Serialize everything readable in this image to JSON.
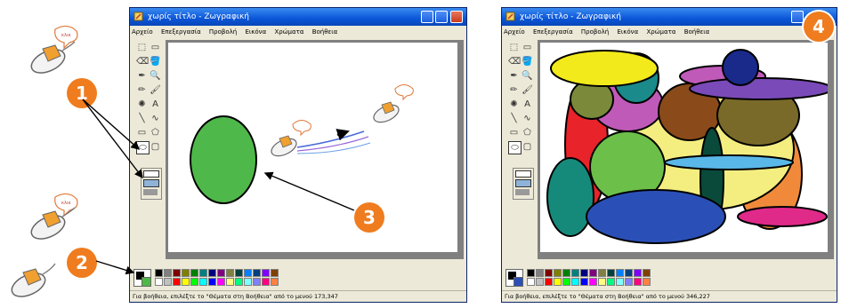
{
  "window1": {
    "title": "χωρίς τίτλο - Ζωγραφική",
    "menus": [
      "Αρχείο",
      "Επεξεργασία",
      "Προβολή",
      "Εικόνα",
      "Χρώματα",
      "Βοήθεια"
    ],
    "status": "Για βοήθεια, επιλέξτε το \"Θέματα στη Βοήθεια\" από το μενού  173,347"
  },
  "window2": {
    "title": "χωρίς τίτλο - Ζωγραφική",
    "menus": [
      "Αρχείο",
      "Επεξεργασία",
      "Προβολή",
      "Εικόνα",
      "Χρώματα",
      "Βοήθεια"
    ],
    "status": "Για βοήθεια, επιλέξτε το \"Θέματα στη Βοήθεια\" από το μενού  346,227"
  },
  "badges": [
    "1",
    "2",
    "3",
    "4"
  ],
  "mouse_label": "κλικ",
  "tools": [
    "free-select-icon",
    "select-icon",
    "eraser-icon",
    "fill-icon",
    "picker-icon",
    "magnifier-icon",
    "pencil-icon",
    "brush-icon",
    "airbrush-icon",
    "text-icon",
    "line-icon",
    "curve-icon",
    "rectangle-icon",
    "polygon-icon",
    "ellipse-icon",
    "rounded-rect-icon"
  ],
  "tool_glyphs": [
    "⬚",
    "▭",
    "⌫",
    "🪣",
    "✒",
    "🔍",
    "✏",
    "🖌",
    "✺",
    "A",
    "╲",
    "∿",
    "▭",
    "⬠",
    "⬭",
    "▢"
  ],
  "palette_colors": [
    "#000000",
    "#808080",
    "#800000",
    "#808000",
    "#008000",
    "#008080",
    "#000080",
    "#800080",
    "#808040",
    "#004040",
    "#0080ff",
    "#004080",
    "#8000ff",
    "#804000",
    "#ffffff",
    "#c0c0c0",
    "#ff0000",
    "#ffff00",
    "#00ff00",
    "#00ffff",
    "#0000ff",
    "#ff00ff",
    "#ffff80",
    "#00ff80",
    "#80ffff",
    "#8080ff",
    "#ff0080",
    "#ff8040"
  ],
  "colors": {
    "green_ellipse": "#4fb84a",
    "badge": "#ef7c1e",
    "titlebar": "#0b55d8"
  }
}
